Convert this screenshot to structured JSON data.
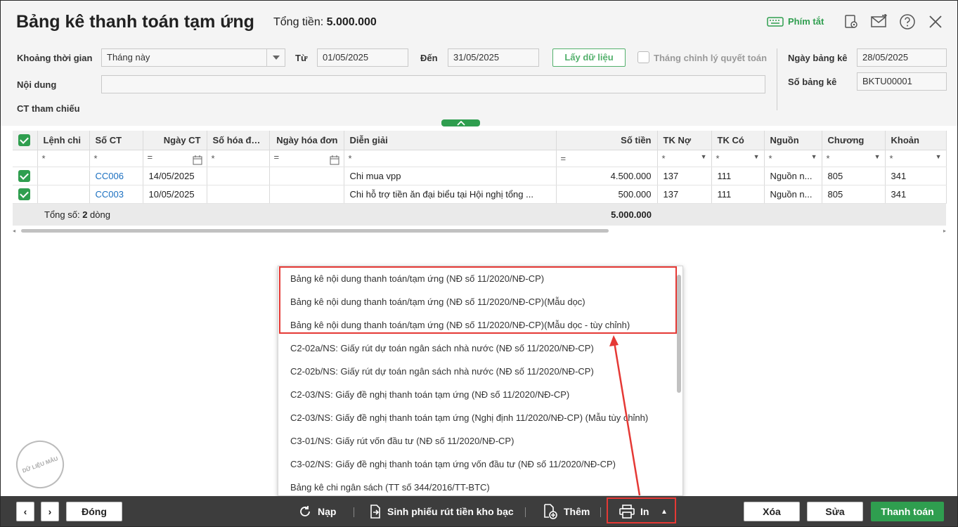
{
  "header": {
    "title": "Bảng kê thanh toán tạm ứng",
    "total_label": "Tổng tiền: ",
    "total_value": "5.000.000",
    "hotkey_label": "Phím tắt"
  },
  "form": {
    "period_label": "Khoảng thời gian",
    "period_value": "Tháng này",
    "from_label": "Từ",
    "from_value": "01/05/2025",
    "to_label": "Đến",
    "to_value": "31/05/2025",
    "fetch_button": "Lấy dữ liệu",
    "adjust_checkbox_label": "Tháng chỉnh lý quyết toán",
    "statement_date_label": "Ngày bảng kê",
    "statement_date_value": "28/05/2025",
    "statement_no_label": "Số bảng kê",
    "statement_no_value": "BKTU00001",
    "content_label": "Nội dung",
    "content_value": "",
    "reference_label": "CT tham chiếu"
  },
  "table": {
    "columns": [
      "Lệnh chi",
      "Số CT",
      "Ngày CT",
      "Số hóa đơn",
      "Ngày hóa đơn",
      "Diễn giải",
      "Số tiền",
      "TK Nợ",
      "TK Có",
      "Nguồn",
      "Chương",
      "Khoản"
    ],
    "filters": [
      "*",
      "*",
      "=",
      "*",
      "=",
      "*",
      "=",
      "*",
      "*",
      "*",
      "*",
      "*"
    ],
    "rows": [
      {
        "lenh_chi": "",
        "so_ct": "CC006",
        "ngay_ct": "14/05/2025",
        "so_hd": "",
        "ngay_hd": "",
        "dien_giai": "Chi mua vpp",
        "so_tien": "4.500.000",
        "tk_no": "137",
        "tk_co": "111",
        "nguon": "Nguồn n...",
        "chuong": "805",
        "khoan": "341"
      },
      {
        "lenh_chi": "",
        "so_ct": "CC003",
        "ngay_ct": "10/05/2025",
        "so_hd": "",
        "ngay_hd": "",
        "dien_giai": "Chi hỗ trợ tiền ăn đại biểu tại Hội nghị tổng ...",
        "so_tien": "500.000",
        "tk_no": "137",
        "tk_co": "111",
        "nguon": "Nguồn n...",
        "chuong": "805",
        "khoan": "341"
      }
    ],
    "footer_label": "Tổng số: ",
    "footer_count": "2",
    "footer_suffix": " dòng",
    "footer_total": "5.000.000"
  },
  "print_menu": {
    "items": [
      "Bảng kê nội dung thanh toán/tạm ứng (NĐ số 11/2020/NĐ-CP)",
      "Bảng kê nội dung thanh toán/tạm ứng (NĐ số 11/2020/NĐ-CP)(Mẫu dọc)",
      "Bảng kê nội dung thanh toán/tạm ứng (NĐ số 11/2020/NĐ-CP)(Mẫu dọc - tùy chỉnh)",
      "C2-02a/NS: Giấy rút dự toán ngân sách nhà nước (NĐ số 11/2020/NĐ-CP)",
      "C2-02b/NS: Giấy rút dự toán ngân sách nhà nước (NĐ số 11/2020/NĐ-CP)",
      "C2-03/NS: Giấy đề nghị thanh toán tạm ứng (NĐ số 11/2020/NĐ-CP)",
      "C2-03/NS: Giấy đề nghị thanh toán tạm ứng (Nghị định 11/2020/NĐ-CP) (Mẫu tùy chỉnh)",
      "C3-01/NS: Giấy rút vốn đầu tư (NĐ số 11/2020/NĐ-CP)",
      "C3-02/NS: Giấy đề nghị thanh toán tạm ứng vốn đầu tư (NĐ số 11/2020/NĐ-CP)",
      "Bảng kê chi ngân sách (TT số 344/2016/TT-BTC)"
    ]
  },
  "footer": {
    "close_button": "Đóng",
    "reload_button": "Nạp",
    "treasury_button": "Sinh phiếu rút tiền kho bạc",
    "add_button": "Thêm",
    "print_button": "In",
    "delete_button": "Xóa",
    "edit_button": "Sửa",
    "pay_button": "Thanh toán"
  },
  "stamp_text": "DỮ LIỆU MẪU",
  "colors": {
    "accent": "#2f9e4f",
    "highlight": "#e53935",
    "link": "#1a6fc0",
    "footer_bg": "#3d3d3d"
  }
}
